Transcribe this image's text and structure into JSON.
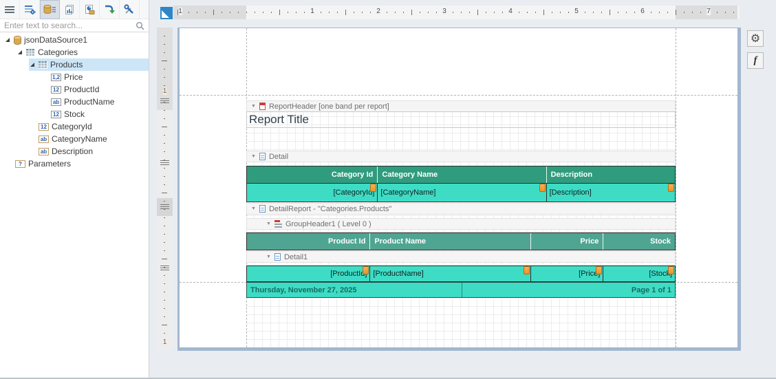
{
  "toolbar": {
    "tabs": [
      {
        "name": "menu"
      },
      {
        "name": "properties"
      },
      {
        "name": "field-list",
        "active": true
      },
      {
        "name": "report-explorer"
      },
      {
        "name": "report-preview"
      },
      {
        "name": "export"
      },
      {
        "name": "tools"
      }
    ]
  },
  "search": {
    "placeholder": "Enter text to search...",
    "value": ""
  },
  "field_list": {
    "items": [
      {
        "label": "jsonDataSource1",
        "icon": "datasource",
        "level": 0,
        "expanded": true
      },
      {
        "label": "Categories",
        "icon": "table",
        "level": 1,
        "expanded": true
      },
      {
        "label": "Products",
        "icon": "table",
        "level": 2,
        "expanded": true,
        "selected": true
      },
      {
        "label": "Price",
        "icon": "field",
        "badge": "1,2",
        "level": 3
      },
      {
        "label": "ProductId",
        "icon": "field",
        "badge": "12",
        "level": 3
      },
      {
        "label": "ProductName",
        "icon": "field",
        "badge": "ab",
        "level": 3
      },
      {
        "label": "Stock",
        "icon": "field",
        "badge": "12",
        "level": 3
      },
      {
        "label": "CategoryId",
        "icon": "field-bound",
        "badge": "12",
        "level": 2
      },
      {
        "label": "CategoryName",
        "icon": "field-bound",
        "badge": "ab",
        "level": 2
      },
      {
        "label": "Description",
        "icon": "field-bound",
        "badge": "ab",
        "level": 2
      },
      {
        "label": "Parameters",
        "icon": "parameters",
        "badge": "?",
        "level": 0
      }
    ]
  },
  "ruler": {
    "h_numbers": [
      "1",
      "1",
      "2",
      "3",
      "4",
      "5",
      "6",
      "7"
    ],
    "v_numbers": [
      "1",
      "1"
    ]
  },
  "bands": {
    "report_header": "ReportHeader [one band per report]",
    "detail": "Detail",
    "detail_report": "DetailReport - \"Categories.Products\"",
    "group_header": "GroupHeader1 ( Level 0 )",
    "detail1": "Detail1"
  },
  "report": {
    "title": "Report Title",
    "category_table": {
      "headers": [
        "Category Id",
        "Category Name",
        "Description"
      ],
      "cells": [
        "[CategoryId]",
        "[CategoryName]",
        "[Description]"
      ]
    },
    "product_table": {
      "headers": [
        "Product Id",
        "Product Name",
        "Price",
        "Stock"
      ],
      "cells": [
        "[ProductId]",
        "[ProductName]",
        "[Price]",
        "[Stock]"
      ]
    },
    "page_footer": {
      "date": "Thursday, November 27, 2025",
      "page_info": "Page 1 of 1"
    }
  },
  "side_panel": {
    "settings_glyph": "⚙",
    "script_glyph": "f"
  },
  "colors": {
    "category_header": "#2F9C7E",
    "product_header": "#4FA591",
    "data_row": "#3EDCC5",
    "binding_icon": "#ED9426",
    "selection": "#CDE6F7",
    "page_border": "#A3B7CF"
  }
}
